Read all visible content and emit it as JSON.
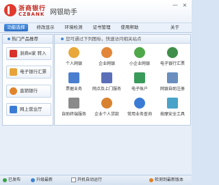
{
  "titlebar": {
    "bank_name": "浙商银行",
    "bank_en": "CZBANK",
    "app_title": "网银助手",
    "controls": [
      "—",
      "×"
    ]
  },
  "tabs": [
    {
      "label": "功能选择",
      "active": true
    },
    {
      "label": "修改显示",
      "active": false
    },
    {
      "label": "环境检测",
      "active": false
    },
    {
      "label": "证书管理",
      "active": false
    },
    {
      "label": "使用帮助",
      "active": false
    },
    {
      "label": "关于",
      "active": false
    }
  ],
  "left_panel": {
    "heading": "热门产品推荐",
    "products": [
      {
        "label": "浙商e家 转入",
        "icon": "ecash-icon",
        "color": "#d9322a"
      },
      {
        "label": "电子银行汇票",
        "icon": "bill-icon",
        "color": "#e7a33a"
      },
      {
        "label": "直销银行",
        "icon": "direct-bank-icon",
        "color": "#e0832a"
      },
      {
        "label": "网上营业厅",
        "icon": "online-hall-icon",
        "color": "#3a7bd5"
      }
    ]
  },
  "right_panel": {
    "heading": "您可通过下列图标，快速访问相关站点",
    "tiles": [
      {
        "label": "个人网银",
        "icon": "personal-banking-icon",
        "color": "#e8a93a"
      },
      {
        "label": "企业网银",
        "icon": "corporate-banking-icon",
        "color": "#e2873a"
      },
      {
        "label": "小企业网银",
        "icon": "small-business-banking-icon",
        "color": "#4fa84a"
      },
      {
        "label": "电子银行汇票",
        "icon": "e-bill-icon",
        "color": "#3f8f4a"
      },
      {
        "label": "票据业务",
        "icon": "bill-business-icon",
        "color": "#4a7fcf"
      },
      {
        "label": "网点及上门服务",
        "icon": "branch-service-icon",
        "color": "#5a6fb8"
      },
      {
        "label": "电子账户",
        "icon": "e-account-icon",
        "color": "#3a9a5a"
      },
      {
        "label": "网银自助注册",
        "icon": "self-register-icon",
        "color": "#6a8fbf"
      },
      {
        "label": "自助终端服务",
        "icon": "self-terminal-icon",
        "color": "#8a8a8a"
      },
      {
        "label": "企业个人贷款",
        "icon": "loan-icon",
        "color": "#d8822f"
      },
      {
        "label": "常用业务查询",
        "icon": "query-icon",
        "color": "#3a7bd5"
      },
      {
        "label": "按摩安全工具",
        "icon": "security-tool-icon",
        "color": "#4aa3c8"
      }
    ]
  },
  "statusbar": {
    "items": [
      "已发布",
      "升级最新",
      "开机自动运行"
    ],
    "right": "检测到最新版本"
  }
}
